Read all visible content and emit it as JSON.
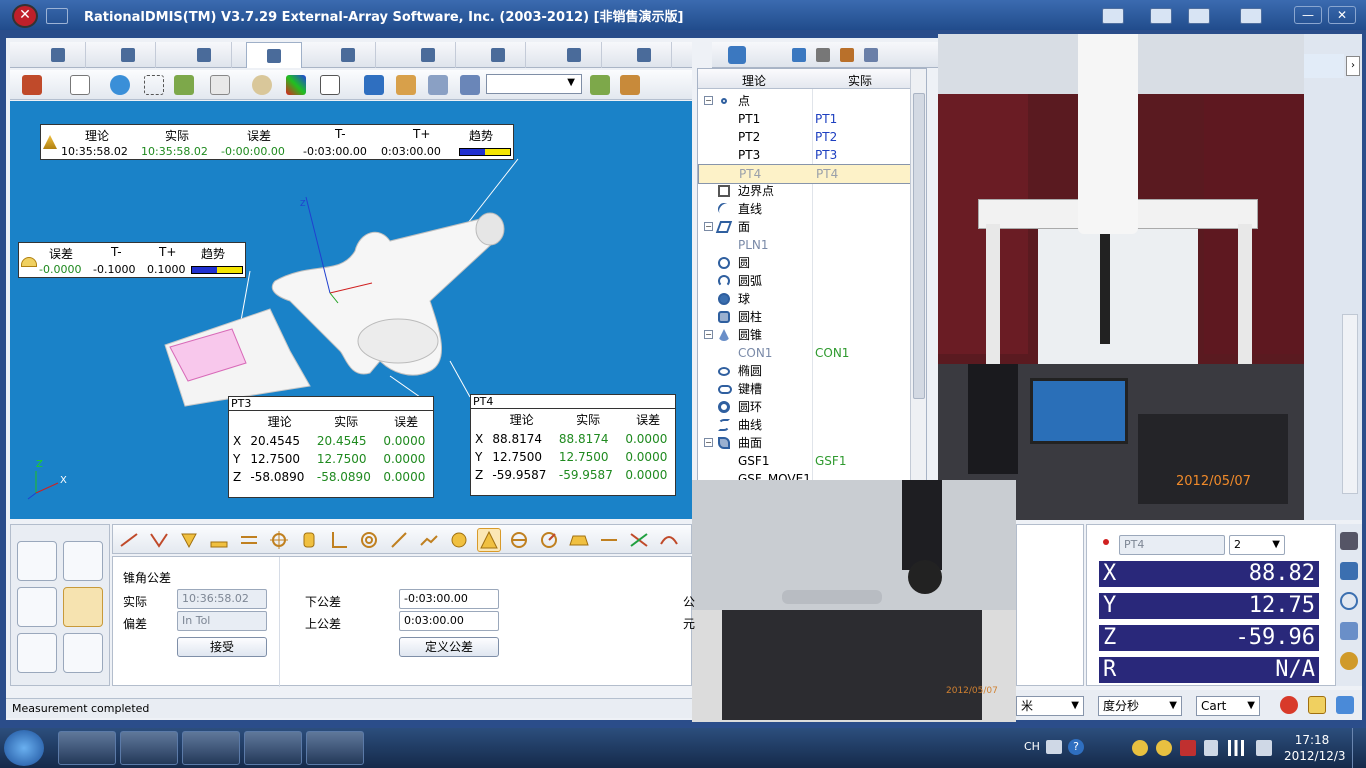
{
  "window": {
    "title": "RationalDMIS(TM) V3.7.29    External-Array Software, Inc. (2003-2012) [非销售演示版]"
  },
  "viewport": {
    "box_top": {
      "headers": [
        "理论",
        "实际",
        "误差",
        "T-",
        "T+",
        "趋势"
      ],
      "values": [
        "10:35:58.02",
        "10:35:58.02",
        "-0:00:00.00",
        "-0:03:00.00",
        "0:03:00.00"
      ]
    },
    "box_left": {
      "headers": [
        "误差",
        "T-",
        "T+",
        "趋势"
      ],
      "values": [
        "-0.0000",
        "-0.1000",
        "0.1000"
      ]
    },
    "pt3": {
      "title": "PT3",
      "headers": [
        "理论",
        "实际",
        "误差"
      ],
      "rows": [
        {
          "axis": "X",
          "nominal": "20.4545",
          "actual": "20.4545",
          "dev": "0.0000"
        },
        {
          "axis": "Y",
          "nominal": "12.7500",
          "actual": "12.7500",
          "dev": "0.0000"
        },
        {
          "axis": "Z",
          "nominal": "-58.0890",
          "actual": "-58.0890",
          "dev": "0.0000"
        }
      ]
    },
    "pt4": {
      "title": "PT4",
      "headers": [
        "理论",
        "实际",
        "误差"
      ],
      "rows": [
        {
          "axis": "X",
          "nominal": "88.8174",
          "actual": "88.8174",
          "dev": "0.0000"
        },
        {
          "axis": "Y",
          "nominal": "12.7500",
          "actual": "12.7500",
          "dev": "0.0000"
        },
        {
          "axis": "Z",
          "nominal": "-59.9587",
          "actual": "-59.9587",
          "dev": "0.0000"
        }
      ]
    },
    "axis_z": "Z",
    "axis_x": "X"
  },
  "tree": {
    "col_nominal": "理论",
    "col_actual": "实际",
    "rows": [
      {
        "label": "点",
        "actual": ""
      },
      {
        "label": "PT1",
        "actual": "PT1"
      },
      {
        "label": "PT2",
        "actual": "PT2"
      },
      {
        "label": "PT3",
        "actual": "PT3"
      },
      {
        "label": "PT4",
        "actual": "PT4"
      },
      {
        "label": "边界点",
        "actual": ""
      },
      {
        "label": "直线",
        "actual": ""
      },
      {
        "label": "面",
        "actual": ""
      },
      {
        "label": "PLN1",
        "actual": ""
      },
      {
        "label": "圆",
        "actual": ""
      },
      {
        "label": "圆弧",
        "actual": ""
      },
      {
        "label": "球",
        "actual": ""
      },
      {
        "label": "圆柱",
        "actual": ""
      },
      {
        "label": "圆锥",
        "actual": ""
      },
      {
        "label": "CON1",
        "actual": "CON1"
      },
      {
        "label": "椭圆",
        "actual": ""
      },
      {
        "label": "键槽",
        "actual": ""
      },
      {
        "label": "圆环",
        "actual": ""
      },
      {
        "label": "曲线",
        "actual": ""
      },
      {
        "label": "曲面",
        "actual": ""
      },
      {
        "label": "GSF1",
        "actual": "GSF1"
      },
      {
        "label": "GSF_MOVE1",
        "actual": ""
      }
    ]
  },
  "photos": {
    "date1": "2012/05/07",
    "date2": "2012/05/07"
  },
  "tolerance": {
    "title": "锥角公差",
    "actual_label": "实际",
    "actual_value": "10:36:58.02",
    "dev_label": "偏差",
    "dev_value": "In Tol",
    "accept": "接受",
    "lower_label": "下公差",
    "lower_value": "-0:03:00.00",
    "upper_label": "上公差",
    "upper_value": "0:03:00.00",
    "define": "定义公差",
    "clip1": "公",
    "clip2": "元"
  },
  "status": "Measurement completed",
  "readout": {
    "point": "PT4",
    "probe": "2",
    "x_label": "X",
    "x_value": "88.82",
    "y_label": "Y",
    "y_value": "12.75",
    "z_label": "Z",
    "z_value": "-59.96",
    "r_label": "R",
    "r_value": "N/A"
  },
  "units": {
    "length": "米",
    "angle": "度分秒",
    "coord": "Cart"
  },
  "taskbar": {
    "lang": "CH",
    "time": "17:18",
    "date": "2012/12/3"
  },
  "accent": "#1a82c8"
}
